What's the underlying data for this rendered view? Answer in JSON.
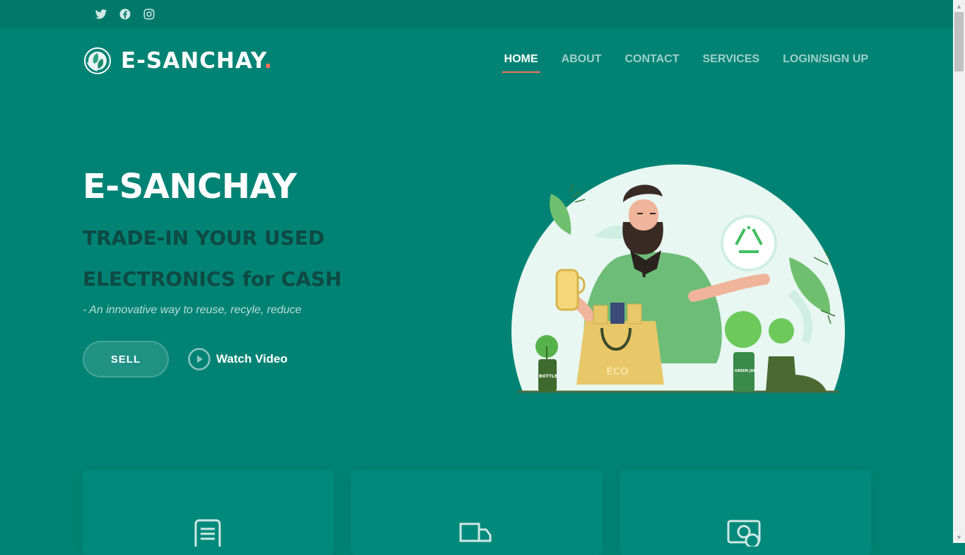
{
  "social": {
    "icons": [
      "twitter-icon",
      "facebook-icon",
      "instagram-icon"
    ]
  },
  "brand": {
    "name": "E-SANCHAY",
    "dot": ".",
    "logo_icon": "leaf-globe-icon"
  },
  "nav": {
    "items": [
      {
        "label": "HOME",
        "active": true
      },
      {
        "label": "ABOUT",
        "active": false
      },
      {
        "label": "CONTACT",
        "active": false
      },
      {
        "label": "SERVICES",
        "active": false
      },
      {
        "label": "LOGIN/SIGN UP",
        "active": false
      }
    ]
  },
  "hero": {
    "title": "E-SANCHAY",
    "subtitle_line1": "TRADE-IN YOUR USED",
    "subtitle_line2": "ELECTRONICS for CASH",
    "tagline": "- An innovative way to reuse, recyle, reduce",
    "sell_label": "SELL",
    "watch_label": "Watch Video",
    "illustration_texts": {
      "bag": "ECO",
      "bottle": "BOTTLE",
      "can": "GREEN JUICE"
    }
  },
  "cards": [
    {
      "icon": "document-icon"
    },
    {
      "icon": "truck-icon"
    },
    {
      "icon": "cash-icon"
    }
  ],
  "colors": {
    "background": "#008374",
    "topbar": "#00796b",
    "accent": "#f96f59",
    "subtitle": "#0e4a43"
  }
}
